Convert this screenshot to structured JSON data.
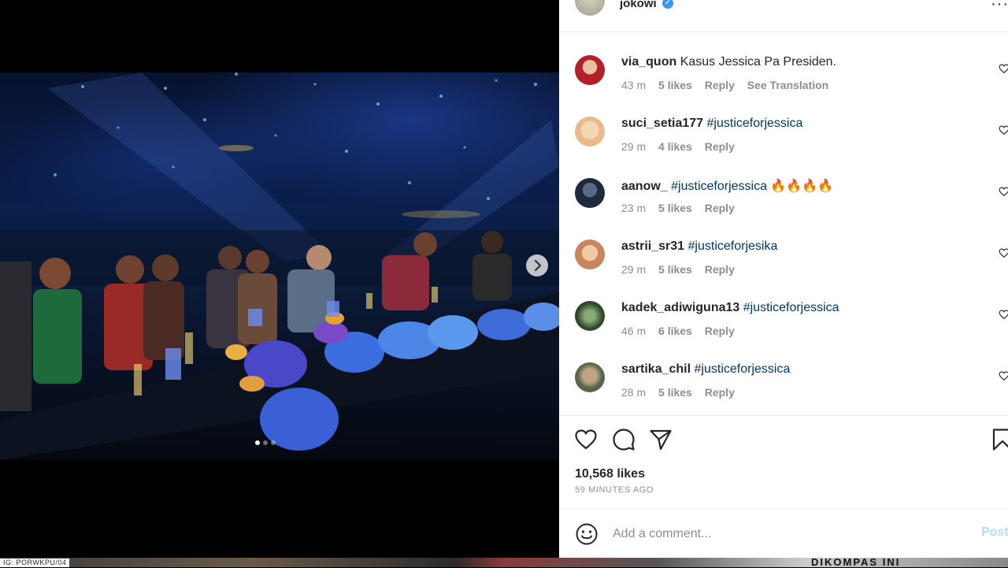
{
  "post": {
    "username": "jokowi",
    "likes": "10,568 likes",
    "time_ago": "59 MINUTES AGO",
    "comment_placeholder": "Add a comment...",
    "post_label": "Post"
  },
  "comments": [
    {
      "user": "via_quon",
      "text": "Kasus Jessica Pa Presiden.",
      "tag": "",
      "emoji": "",
      "time": "43 m",
      "likes": "5 likes",
      "reply": "Reply",
      "translate": "See Translation",
      "avatar_color": "#b3202a"
    },
    {
      "user": "suci_setia177",
      "text": "",
      "tag": "#justiceforjessica",
      "emoji": "",
      "time": "29 m",
      "likes": "4 likes",
      "reply": "Reply",
      "translate": "",
      "avatar_color": "#f0c9a0"
    },
    {
      "user": "aanow_",
      "text": "",
      "tag": "#justiceforjessica",
      "emoji": "🔥🔥🔥🔥",
      "time": "23 m",
      "likes": "5 likes",
      "reply": "Reply",
      "translate": "",
      "avatar_color": "#2b3548"
    },
    {
      "user": "astrii_sr31",
      "text": "",
      "tag": "#justiceforjesika",
      "emoji": "",
      "time": "29 m",
      "likes": "5 likes",
      "reply": "Reply",
      "translate": "",
      "avatar_color": "#d9a27a"
    },
    {
      "user": "kadek_adiwiguna13",
      "text": "",
      "tag": "#justiceforjessica",
      "emoji": "",
      "time": "46 m",
      "likes": "6 likes",
      "reply": "Reply",
      "translate": "",
      "avatar_color": "#3d5a33"
    },
    {
      "user": "sartika_chil",
      "text": "",
      "tag": "#justiceforjessica",
      "emoji": "",
      "time": "28 m",
      "likes": "5 likes",
      "reply": "Reply",
      "translate": "",
      "avatar_color": "#6b7a5a"
    }
  ],
  "carousel": {
    "dots": 3,
    "active": 0
  },
  "bottom_strip": {
    "left_text": "IG: PORWKPU/04",
    "right_text": "DIKOMPAS INI"
  },
  "icons": {
    "like": "heart-icon",
    "comment": "comment-bubble-icon",
    "share": "paper-plane-icon",
    "save": "bookmark-icon",
    "emoji": "smiley-icon",
    "more": "ellipsis-icon",
    "next": "chevron-right-icon"
  }
}
